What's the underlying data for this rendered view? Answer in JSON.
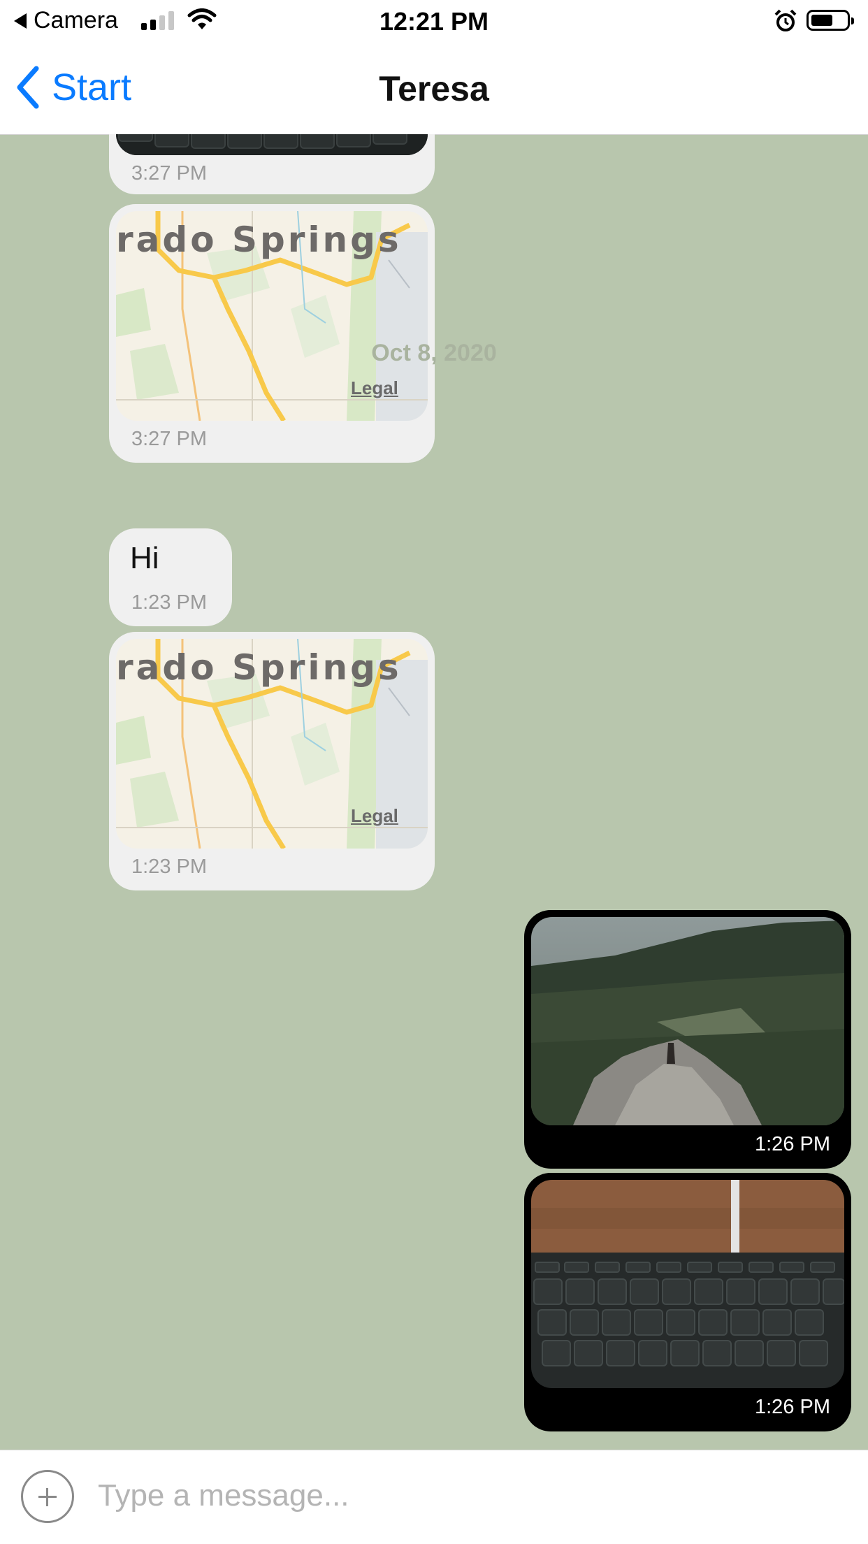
{
  "status_bar": {
    "back_app": "Camera",
    "time": "12:21 PM"
  },
  "nav": {
    "back_label": "Start",
    "title": "Teresa"
  },
  "messages": [
    {
      "type": "image",
      "direction": "incoming",
      "time": "3:27 PM"
    },
    {
      "type": "map",
      "direction": "incoming",
      "map_label": "rado Springs",
      "legal": "Legal",
      "time": "3:27 PM"
    },
    {
      "type": "date_separator",
      "text": "Oct 8, 2020"
    },
    {
      "type": "text",
      "direction": "incoming",
      "text": "Hi",
      "time": "1:23 PM"
    },
    {
      "type": "map",
      "direction": "incoming",
      "map_label": "rado Springs",
      "legal": "Legal",
      "time": "1:23 PM"
    },
    {
      "type": "image",
      "direction": "outgoing",
      "time": "1:26 PM"
    },
    {
      "type": "image",
      "direction": "outgoing",
      "time": "1:26 PM"
    }
  ],
  "composer": {
    "placeholder": "Type a message..."
  },
  "colors": {
    "accent": "#0a7bff",
    "chat_background": "#b8c6ad",
    "incoming_bubble": "#f0f0f0",
    "outgoing_bubble": "#000000"
  },
  "icons": [
    "back-arrow-icon",
    "signal-icon",
    "wifi-icon",
    "alarm-icon",
    "battery-icon",
    "chevron-left-icon",
    "plus-icon"
  ]
}
